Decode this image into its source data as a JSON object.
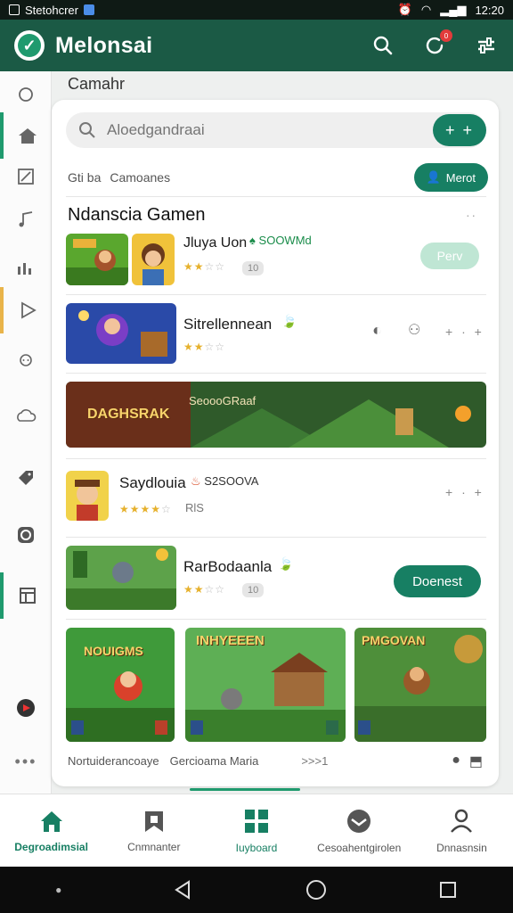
{
  "status_bar": {
    "app_label": "Stetohcrer",
    "time": "12:20"
  },
  "app_bar": {
    "title": "Melonsai",
    "notification_count": "0"
  },
  "breadcrumb": "Camahr",
  "search": {
    "placeholder": "Aloedgandraai",
    "add_label": "+ +"
  },
  "filters": {
    "label_1": "Gti ba",
    "label_2": "Camoanes",
    "action_label": "Merot"
  },
  "section": {
    "title": "Ndanscia Gamen",
    "more": "⋅⋅"
  },
  "rows": [
    {
      "title": "Jluya Uon",
      "extra": "SOOWMd",
      "tag": "10",
      "action": "Perv",
      "rating": 2
    },
    {
      "title": "Sitrellennean",
      "rating": 2
    },
    {
      "banner_title": "DAGHSRAK",
      "banner_text": "SeoooGRaaf"
    },
    {
      "title": "Saydlouia",
      "extra": "S2SOOVA",
      "tag": "RlS",
      "rating": 4
    },
    {
      "title": "RarBodaanla",
      "tag": "10",
      "action": "Doenest",
      "rating": 2
    }
  ],
  "grid": [
    {
      "caption": "NOUIGMS"
    },
    {
      "caption": "INHYEEEN"
    },
    {
      "caption": "PMGOVAN"
    }
  ],
  "footer": {
    "text_1": "Nortuiderancoaye",
    "text_2": "Gercioama Maria",
    "arrows": ">>>1"
  },
  "bottom_nav": [
    {
      "label": "Degroadimsial",
      "icon": "home-icon",
      "active": true
    },
    {
      "label": "Cnmnanter",
      "icon": "bookmark-icon",
      "active": false
    },
    {
      "label": "Iuyboard",
      "icon": "grid-icon",
      "active": true
    },
    {
      "label": "Cesoahentgirolen",
      "icon": "inbox-icon",
      "active": false
    },
    {
      "label": "Dnnasnsin",
      "icon": "profile-icon",
      "active": false
    }
  ],
  "colors": {
    "primary": "#1b5a45",
    "accent": "#177f63",
    "star": "#e6b12d"
  }
}
